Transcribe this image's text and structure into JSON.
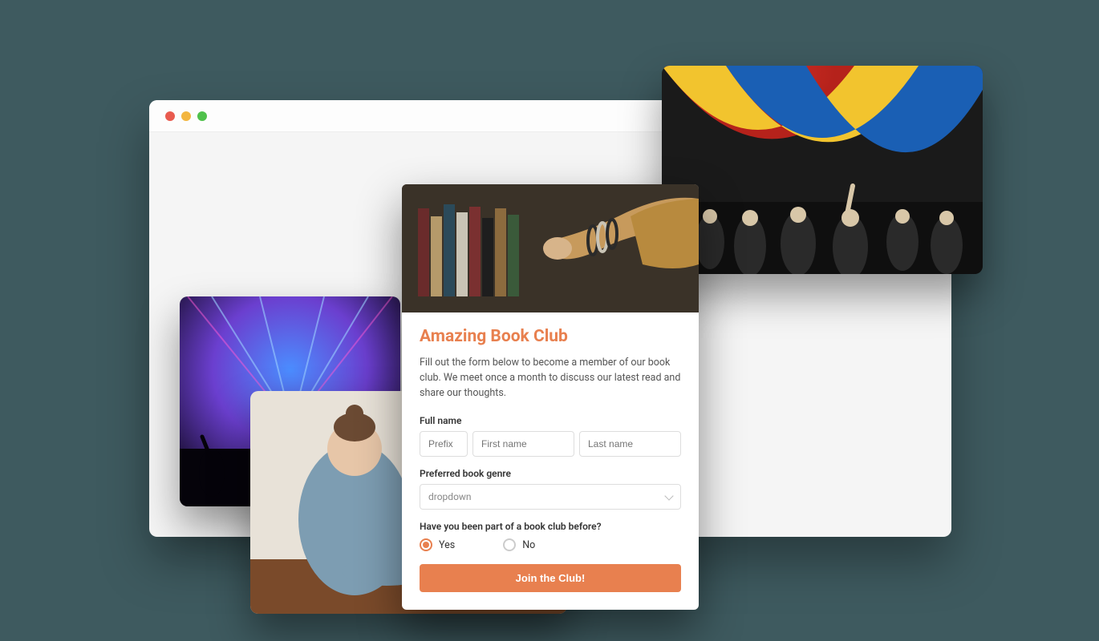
{
  "form": {
    "title": "Amazing Book Club",
    "description": "Fill out the form below to become a member of our book club. We meet once a month to discuss our latest read and share our thoughts.",
    "fullname_label": "Full name",
    "prefix_placeholder": "Prefix",
    "firstname_placeholder": "First name",
    "lastname_placeholder": "Last name",
    "genre_label": "Preferred book genre",
    "genre_placeholder": "dropdown",
    "prior_label": "Have you been part of a book club before?",
    "radio_yes": "Yes",
    "radio_no": "No",
    "submit_label": "Join the Club!",
    "selected_radio": "yes"
  },
  "colors": {
    "accent": "#e8804f",
    "background": "#3e5a5f"
  }
}
